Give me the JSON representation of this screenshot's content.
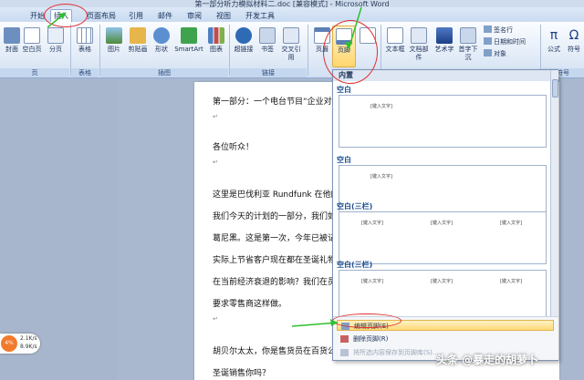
{
  "window": {
    "title": "第一部分听力模拟材料二.doc [兼容模式] - Microsoft Word"
  },
  "tabs": [
    {
      "label": "开始"
    },
    {
      "label": "插入"
    },
    {
      "label": "页面布局"
    },
    {
      "label": "引用"
    },
    {
      "label": "邮件"
    },
    {
      "label": "审阅"
    },
    {
      "label": "视图"
    },
    {
      "label": "开发工具"
    }
  ],
  "ribbon": {
    "buttons": {
      "cover": "封面",
      "blank": "空白页",
      "pagebreak": "分页",
      "table": "表格",
      "picture": "图片",
      "clipart": "剪贴画",
      "shapes": "形状",
      "smartart": "SmartArt",
      "chart": "图表",
      "hyperlink": "超链接",
      "bookmark": "书签",
      "crossref": "交叉引用",
      "header": "页眉",
      "footer": "页脚",
      "textbox": "文本框",
      "quickparts": "文档部件",
      "wordart": "艺术字",
      "dropcap": "首字下沉",
      "signature": "签名行",
      "datetime": "日期和时间",
      "object": "对象",
      "formula": "公式",
      "symbol": "符号"
    },
    "groups": {
      "pages": "页",
      "tables": "表格",
      "illustrations": "插图",
      "links": "链接",
      "symbols": "符号"
    }
  },
  "document": {
    "lines": [
      "第一部分：一个电台节目“企业对招",
      "各位听众！",
      "这里是巴伐利亚 Rundfunk 在他的杂",
      "我们今天的计划的一部分，我们如果",
      "葛尼黑。这是第一次，今年已被记录",
      "实际上节省客户现在都在圣诞礼物",
      "在当前经济衰退的影响？我们在员工",
      "要求零售商这样做。",
      "胡贝尔太太，你是售货员在百货公司",
      "圣诞销售你吗？"
    ],
    "para_mark": "↵"
  },
  "dropdown": {
    "header": "内置",
    "sections": [
      {
        "title": "空白",
        "placeholders": [
          "[键入文字]"
        ]
      },
      {
        "title": "空白",
        "placeholders": [
          "[键入文字]"
        ]
      },
      {
        "title": "空白(三栏)",
        "placeholders": [
          "[键入文字]",
          "[键入文字]",
          "[键入文字]"
        ]
      },
      {
        "title": "空白(三栏)",
        "placeholders": [
          "[键入文字]",
          "[键入文字]",
          "[键入文字]"
        ]
      }
    ],
    "menu": {
      "edit_footer": "编辑页脚(E)",
      "remove_footer": "删除页脚(R)",
      "save_selection": "将所选内容保存到页脚库(S)..."
    }
  },
  "net_widget": {
    "percent": "4%",
    "up": "2.1K/s",
    "down": "8.9K/s"
  },
  "watermark": "头条 @暴走的胡萝卜",
  "colors": {
    "accent": "#1d4e91",
    "annotation": "#e03030",
    "hover": "#ffd978"
  }
}
